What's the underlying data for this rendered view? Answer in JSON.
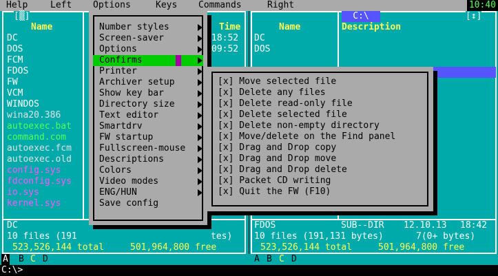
{
  "menubar": {
    "items": [
      "Help",
      "Left",
      "Options",
      "Keys",
      "Commands",
      "Right"
    ],
    "clock": "10:40"
  },
  "left_panel": {
    "indicator": "[▒]",
    "col_name": "Name",
    "col_time": "Time",
    "files": [
      {
        "name": "DC",
        "color": "#ffffff"
      },
      {
        "name": "DOS",
        "color": "#ffffff"
      },
      {
        "name": "FCM",
        "color": "#ffffff"
      },
      {
        "name": "FDOS",
        "color": "#ffffff"
      },
      {
        "name": "FW",
        "color": "#ffffff"
      },
      {
        "name": "VCM",
        "color": "#ffffff"
      },
      {
        "name": "WINDOS",
        "color": "#ffffff"
      },
      {
        "name": "wina20.386",
        "color": "#e0e0e0"
      },
      {
        "name": "autoexec.bat",
        "color": "#55ff55"
      },
      {
        "name": "command.com",
        "color": "#55ff55"
      },
      {
        "name": "autoexec.fcm",
        "color": "#e0e0e0"
      },
      {
        "name": "autoexec.old",
        "color": "#e0e0e0"
      },
      {
        "name": "config.sys",
        "color": "#ff55ff"
      },
      {
        "name": "fdconfig.sys",
        "color": "#ff55ff"
      },
      {
        "name": "io.sys",
        "color": "#ff55ff"
      },
      {
        "name": "kernel.sys",
        "color": "#ff55ff"
      }
    ],
    "times": [
      "18:52",
      "09:52"
    ],
    "current": "DC",
    "files_info": "10 files (191",
    "files_info_tail": "tes)",
    "total": "523,526,144 total",
    "free": "501,964,800 free"
  },
  "right_panel": {
    "path": "C:\\",
    "indicator": "[↕]",
    "col_name": "Name",
    "col_desc": "Description",
    "files": [
      "DC",
      "DOS"
    ],
    "current_name": "FDOS",
    "current_type": "SUB--DIR",
    "current_date": "12.10.13",
    "current_time": "18:42",
    "files_info": "10 files (191,131 bytes)",
    "files_info_extra": "7(0+ bytes)",
    "total": "523,526,144 total",
    "free": "501,964,800 free"
  },
  "options_menu": {
    "items": [
      {
        "label": "Number styles",
        "arrow": true
      },
      {
        "label": "Screen-saver",
        "arrow": true
      },
      {
        "label": "Options",
        "arrow": true
      },
      {
        "label": "Confirms",
        "arrow": true,
        "selected": true
      },
      {
        "label": "Printer",
        "arrow": true
      },
      {
        "label": "Archiver setup",
        "arrow": true
      },
      {
        "label": "Show key bar",
        "arrow": true
      },
      {
        "label": "Directory size",
        "arrow": true
      },
      {
        "label": "Text editor",
        "arrow": true
      },
      {
        "label": "Smartdrv",
        "arrow": true
      },
      {
        "label": "FW startup",
        "arrow": true
      },
      {
        "label": "Fullscreen-mouse",
        "arrow": true
      },
      {
        "label": "Descriptions",
        "arrow": true
      },
      {
        "label": "Colors",
        "arrow": true
      },
      {
        "label": "Video modes",
        "arrow": true
      },
      {
        "label": "ENG/HUN",
        "arrow": true
      },
      {
        "label": "Save config",
        "arrow": false
      }
    ]
  },
  "confirms_menu": {
    "items": [
      "[x] Move selected file",
      "[x] Delete any files",
      "[x] Delete read-only file",
      "[x] Delete selected file",
      "[x] Delete non-empty directory",
      "[x] Move/delete on the Find panel",
      "[x] Drag and Drop copy",
      "[x] Drag and Drop move",
      "[x] Drag and Drop delete",
      "[x] Packet CD writing",
      "[x] Quit the FW (F10)"
    ]
  },
  "drives": {
    "left": [
      "A",
      "B",
      "C",
      "D"
    ],
    "right": [
      "A",
      "B",
      "C",
      "D"
    ]
  },
  "command_line": {
    "prompt": "C:\\>"
  },
  "colors": {
    "panel_bg": "#00aaaa",
    "menu_bg": "#aaaaaa",
    "selected": "#00cc00",
    "heading": "#ffff55",
    "executable": "#55ff55",
    "system_file": "#ff55ff",
    "cursor": "#5555ff"
  }
}
